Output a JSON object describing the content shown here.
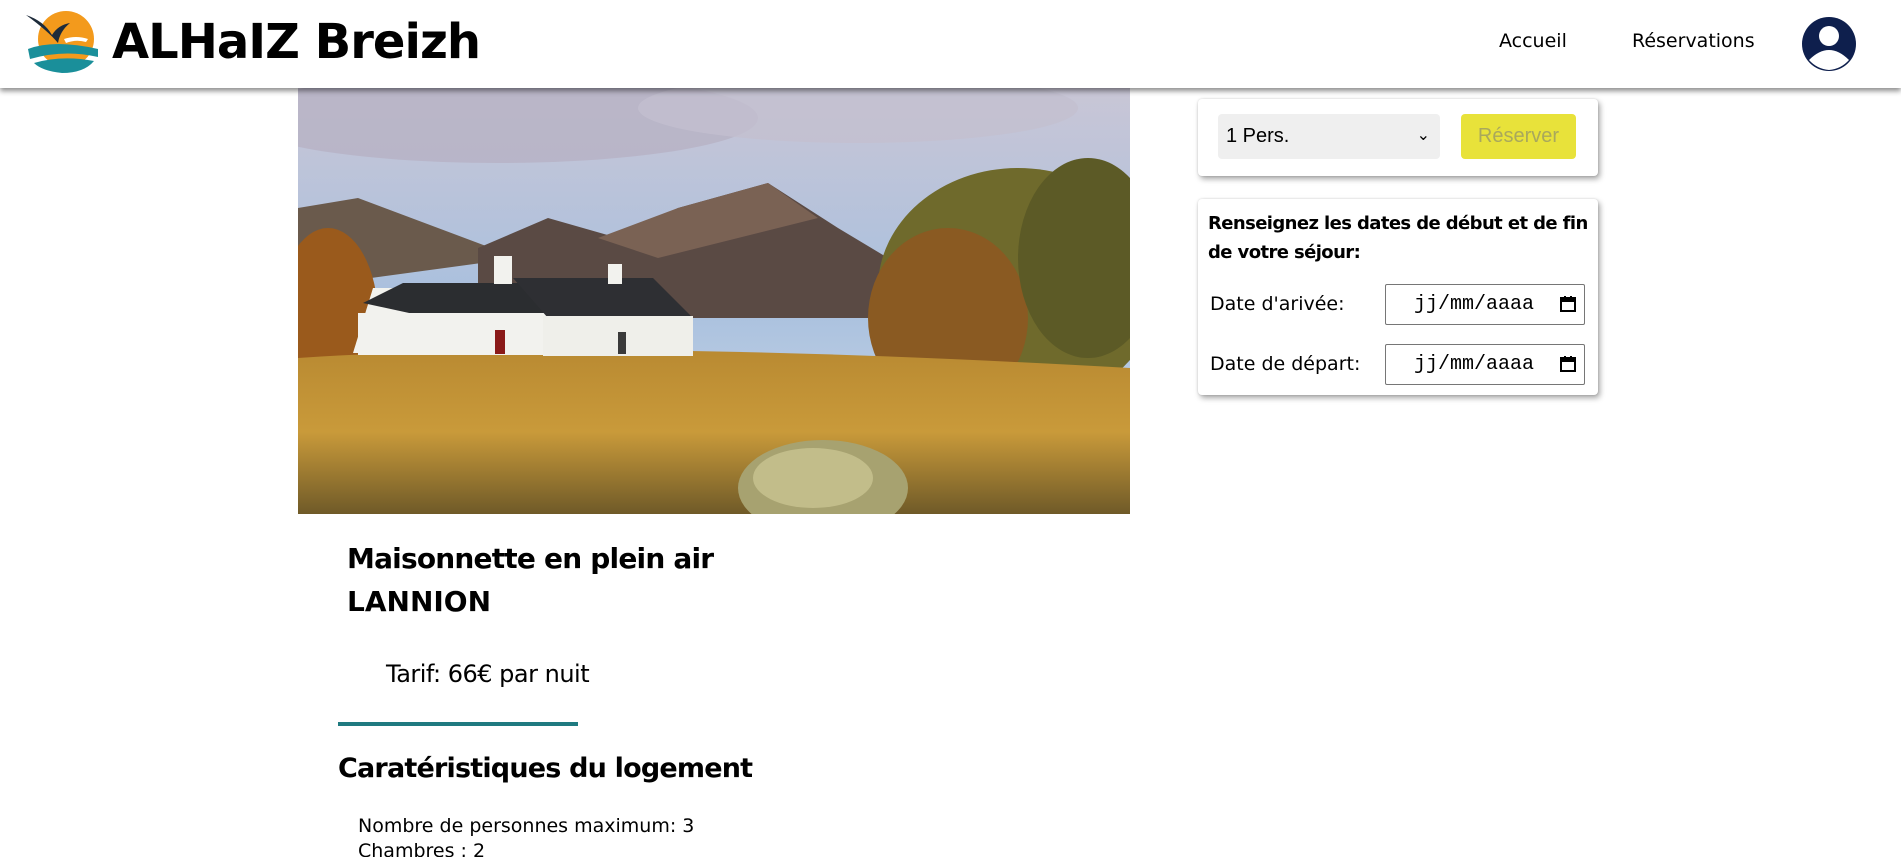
{
  "header": {
    "brand": "ALHaIZ Breizh",
    "nav": {
      "home": "Accueil",
      "reservations": "Réservations"
    },
    "icons": {
      "logo": "bird-sun-logo",
      "avatar": "user-avatar-icon"
    },
    "colors": {
      "logo_orange": "#f39a1c",
      "logo_teal": "#1a8f9a",
      "avatar": "#0e1f4d"
    }
  },
  "listing": {
    "name": "Maisonnette en plein air",
    "city": "LANNION",
    "price": "Tarif: 66€ par nuit",
    "features_title": "Caratéristiques du logement",
    "features": [
      "Nombre de personnes maximum: 3",
      "Chambres : 2"
    ],
    "accent_color": "#1f7a80"
  },
  "booking": {
    "persons_selected": "1 Pers.",
    "reserve_label": "Réserver",
    "reserve_color": "#e8e23a",
    "dates_prompt": "Renseignez les dates de début et de fin de votre séjour:",
    "arrival_label": "Date d'arivée:",
    "departure_label": "Date de départ:",
    "date_placeholder": "jj/mm/aaaa"
  }
}
